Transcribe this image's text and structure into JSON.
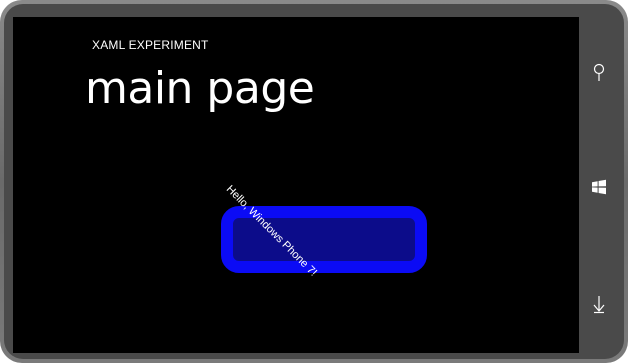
{
  "app": {
    "title": "XAML EXPERIMENT",
    "page_title": "main page"
  },
  "content": {
    "button_text": "Hello, Windows Phone 7!"
  },
  "hardware_buttons": [
    {
      "name": "search",
      "icon": "search-icon"
    },
    {
      "name": "start",
      "icon": "windows-logo-icon"
    },
    {
      "name": "back",
      "icon": "back-arrow-icon"
    }
  ],
  "colors": {
    "screen_background": "#000000",
    "button_border": "#0b0bf5",
    "button_fill": "#0c0c8a",
    "text": "#ffffff",
    "device_frame": "#6a6a6a"
  }
}
